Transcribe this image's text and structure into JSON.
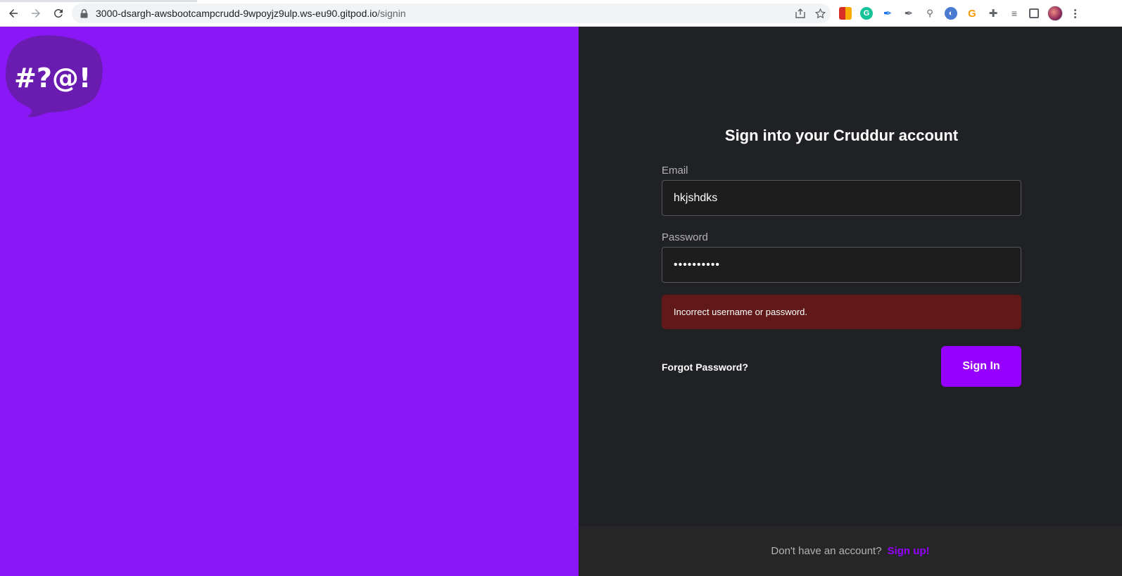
{
  "browser": {
    "url_host": "3000-dsargh-awsbootcampcrudd-9wpoyjz9ulp.ws-eu90.gitpod.io",
    "url_path": "/signin",
    "icons": {
      "back": "arrow-left-icon",
      "forward": "arrow-right-icon",
      "reload": "reload-icon",
      "lock": "lock-icon",
      "share": "share-icon",
      "bookmark": "star-icon"
    }
  },
  "logo": {
    "text": "#?@!",
    "bubble_color": "#6a1bb0"
  },
  "colors": {
    "left_bg": "#8a18f6",
    "right_bg": "#202124",
    "accent": "#9500ff",
    "error_bg": "#601818"
  },
  "signin": {
    "title": "Sign into your Cruddur account",
    "email_label": "Email",
    "email_value": "hkjshdks",
    "password_label": "Password",
    "password_value": "••••••••••",
    "error_message": "Incorrect username or password.",
    "forgot_label": "Forgot Password?",
    "submit_label": "Sign In"
  },
  "footer": {
    "question": "Don't have an account?",
    "signup_label": "Sign up!"
  }
}
